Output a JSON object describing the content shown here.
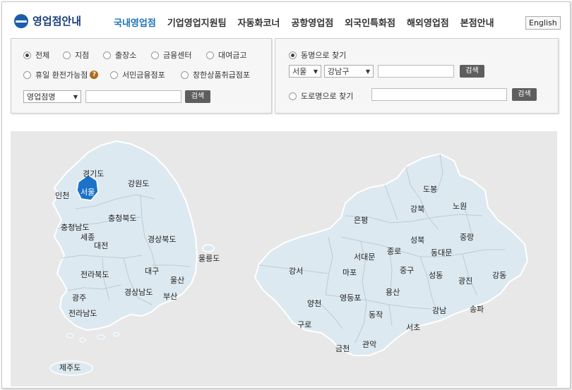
{
  "header": {
    "logo_text": "영업점안내",
    "nav": [
      "국내영업점",
      "기업영업지원팀",
      "자동화코너",
      "공항영업점",
      "외국인특화점",
      "해외영업점",
      "본점안내"
    ],
    "lang": "English"
  },
  "filter": {
    "options": [
      "전체",
      "지점",
      "출장소",
      "금융센터",
      "대여금고",
      "휴일 환전가능점",
      "서민금융점포",
      "창한상품취급점포"
    ],
    "selected": "전체",
    "search_select": "영업점명",
    "search_button": "검색"
  },
  "locator": {
    "dong_label": "동명으로 찾기",
    "city": "서울",
    "district": "강남구",
    "search_button": "검색",
    "road_label": "도로명으로 찾기",
    "road_button": "검색"
  },
  "korea_map": {
    "labels": [
      "경기도",
      "강원도",
      "인천",
      "서울",
      "충청북도",
      "충청남도",
      "세종",
      "대전",
      "경상북도",
      "울릉도",
      "전라북도",
      "대구",
      "울산",
      "경상남도",
      "부산",
      "광주",
      "전라남도",
      "제주도"
    ],
    "highlight": "서울",
    "highlight_color": "#1b73c8"
  },
  "seoul_map": {
    "labels": [
      "도봉",
      "노원",
      "강북",
      "은평",
      "성북",
      "중랑",
      "종로",
      "동대문",
      "서대문",
      "강서",
      "마포",
      "중구",
      "성동",
      "광진",
      "강동",
      "양천",
      "영등포",
      "용산",
      "송파",
      "강남",
      "구로",
      "동작",
      "서초",
      "금천",
      "관악"
    ]
  },
  "colors": {
    "accent": "#1b73b8",
    "map_fill": "#dde9f0"
  }
}
